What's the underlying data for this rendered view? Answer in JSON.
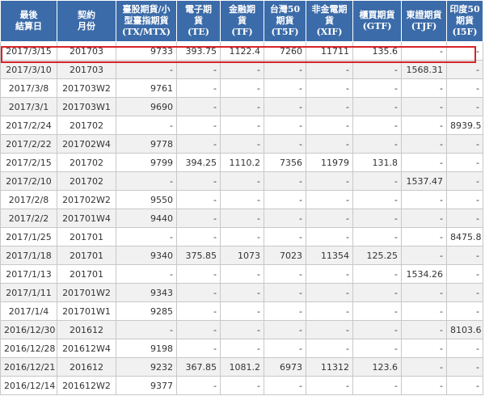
{
  "table": {
    "headers": [
      [
        "最後",
        "結算日"
      ],
      [
        "契約",
        "月份"
      ],
      [
        "臺股期貨/小",
        "型臺指期貨",
        "(TX/MTX)"
      ],
      [
        "電子期",
        "貨",
        "(TE)"
      ],
      [
        "金融期",
        "貨",
        "(TF)"
      ],
      [
        "台灣50",
        "期貨",
        "(T5F)"
      ],
      [
        "非金電期",
        "貨",
        "(XIF)"
      ],
      [
        "櫃買期貨",
        "(GTF)"
      ],
      [
        "東證期貨",
        "(TJF)"
      ],
      [
        "印度50",
        "期貨",
        "(I5F)"
      ]
    ],
    "rows": [
      [
        "2017/3/15",
        "201703",
        "9733",
        "393.75",
        "1122.4",
        "7260",
        "11711",
        "135.6",
        "-",
        "-"
      ],
      [
        "2017/3/10",
        "201703",
        "-",
        "-",
        "-",
        "-",
        "-",
        "-",
        "1568.31",
        "-"
      ],
      [
        "2017/3/8",
        "201703W2",
        "9761",
        "-",
        "-",
        "-",
        "-",
        "-",
        "-",
        "-"
      ],
      [
        "2017/3/1",
        "201703W1",
        "9690",
        "-",
        "-",
        "-",
        "-",
        "-",
        "-",
        "-"
      ],
      [
        "2017/2/24",
        "201702",
        "-",
        "-",
        "-",
        "-",
        "-",
        "-",
        "-",
        "8939.5"
      ],
      [
        "2017/2/22",
        "201702W4",
        "9778",
        "-",
        "-",
        "-",
        "-",
        "-",
        "-",
        "-"
      ],
      [
        "2017/2/15",
        "201702",
        "9799",
        "394.25",
        "1110.2",
        "7356",
        "11979",
        "131.8",
        "-",
        "-"
      ],
      [
        "2017/2/10",
        "201702",
        "-",
        "-",
        "-",
        "-",
        "-",
        "-",
        "1537.47",
        "-"
      ],
      [
        "2017/2/8",
        "201702W2",
        "9550",
        "-",
        "-",
        "-",
        "-",
        "-",
        "-",
        "-"
      ],
      [
        "2017/2/2",
        "201701W4",
        "9440",
        "-",
        "-",
        "-",
        "-",
        "-",
        "-",
        "-"
      ],
      [
        "2017/1/25",
        "201701",
        "-",
        "-",
        "-",
        "-",
        "-",
        "-",
        "-",
        "8475.8"
      ],
      [
        "2017/1/18",
        "201701",
        "9340",
        "375.85",
        "1073",
        "7023",
        "11354",
        "125.25",
        "-",
        "-"
      ],
      [
        "2017/1/13",
        "201701",
        "-",
        "-",
        "-",
        "-",
        "-",
        "-",
        "1534.26",
        "-"
      ],
      [
        "2017/1/11",
        "201701W2",
        "9343",
        "-",
        "-",
        "-",
        "-",
        "-",
        "-",
        "-"
      ],
      [
        "2017/1/4",
        "201701W1",
        "9285",
        "-",
        "-",
        "-",
        "-",
        "-",
        "-",
        "-"
      ],
      [
        "2016/12/30",
        "201612",
        "-",
        "-",
        "-",
        "-",
        "-",
        "-",
        "-",
        "8103.6"
      ],
      [
        "2016/12/28",
        "201612W4",
        "9198",
        "-",
        "-",
        "-",
        "-",
        "-",
        "-",
        "-"
      ],
      [
        "2016/12/21",
        "201612",
        "9232",
        "367.85",
        "1081.2",
        "6973",
        "11312",
        "123.6",
        "-",
        "-"
      ],
      [
        "2016/12/14",
        "201612W2",
        "9377",
        "-",
        "-",
        "-",
        "-",
        "-",
        "-",
        "-"
      ]
    ],
    "highlighted_row": 0
  },
  "colors": {
    "header_bg": "#3b6ba8",
    "header_text": "#ffffff",
    "row_alt": "#f1f1f1",
    "highlight_border": "#d7232a"
  }
}
